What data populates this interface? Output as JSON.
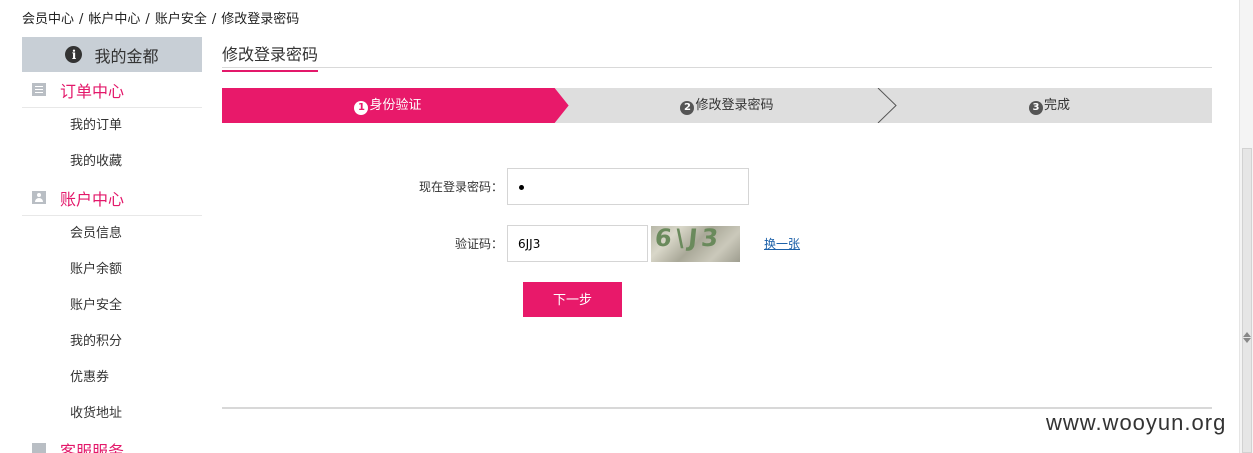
{
  "breadcrumb": {
    "items": [
      "会员中心",
      "帐户中心",
      "账户安全",
      "修改登录密码"
    ],
    "separator": "/"
  },
  "sidebar": {
    "top_label": "我的金都",
    "top_icon": "info-icon",
    "sections": [
      {
        "title": "订单中心",
        "icon": "list-icon",
        "items": [
          "我的订单",
          "我的收藏"
        ]
      },
      {
        "title": "账户中心",
        "icon": "user-icon",
        "items": [
          "会员信息",
          "账户余额",
          "账户安全",
          "我的积分",
          "优惠券",
          "收货地址"
        ]
      },
      {
        "title": "客服服务",
        "icon": "service-icon",
        "items": []
      }
    ]
  },
  "main": {
    "title": "修改登录密码",
    "steps": [
      {
        "num": "1",
        "label": "身份验证",
        "active": true
      },
      {
        "num": "2",
        "label": "修改登录密码",
        "active": false
      },
      {
        "num": "3",
        "label": "完成",
        "active": false
      }
    ],
    "form": {
      "password_label": "现在登录密码：",
      "password_value": "•",
      "captcha_label": "验证码：",
      "captcha_value": "6JJ3",
      "captcha_image_text": "6\\J3",
      "refresh_label": "换一张",
      "next_label": "下一步"
    }
  },
  "watermark": "www.wooyun.org",
  "colors": {
    "accent": "#e8196a",
    "section_title": "#e3186a",
    "sidebar_top_bg": "#c8cfd6",
    "steps_bg": "#dedede",
    "link": "#1a5fa8"
  }
}
